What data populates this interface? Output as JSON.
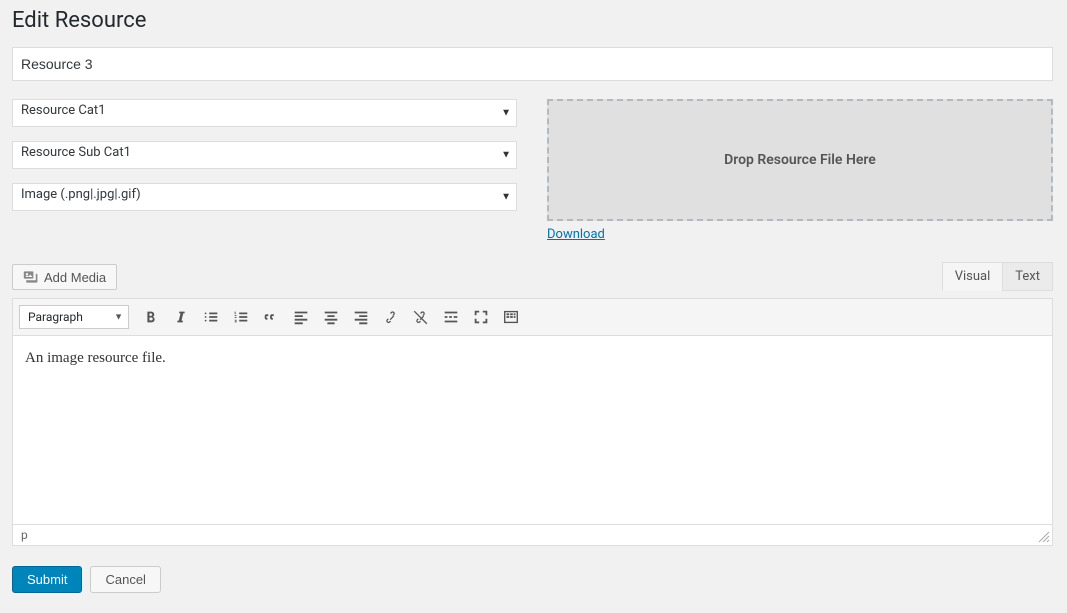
{
  "page_title": "Edit Resource",
  "title_field": {
    "value": "Resource 3"
  },
  "selects": {
    "category": {
      "value": "Resource Cat1"
    },
    "subcategory": {
      "value": "Resource Sub Cat1"
    },
    "filetype": {
      "value": "Image (.png|.jpg|.gif)"
    }
  },
  "dropzone": {
    "label": "Drop Resource File Here"
  },
  "download_link": "Download",
  "add_media_label": "Add Media",
  "editor_tabs": {
    "visual": "Visual",
    "text": "Text"
  },
  "format_select": "Paragraph",
  "editor_body": "An image resource file.",
  "status_path": "p",
  "buttons": {
    "submit": "Submit",
    "cancel": "Cancel"
  }
}
